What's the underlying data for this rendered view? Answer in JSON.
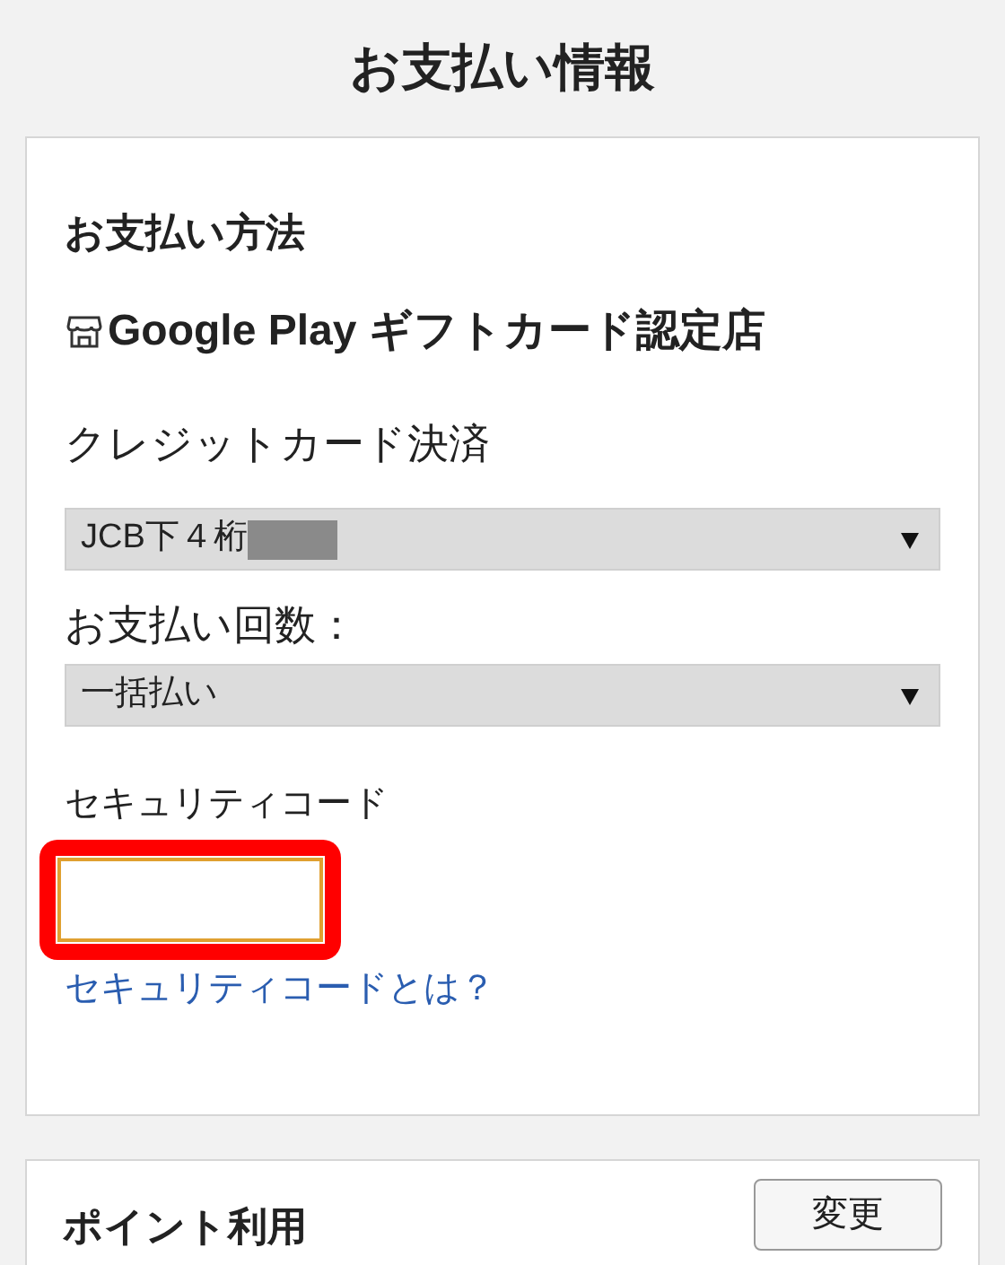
{
  "page_title": "お支払い情報",
  "payment": {
    "heading": "お支払い方法",
    "store": "Google Play ギフトカード認定店",
    "method": "クレジットカード決済",
    "card_select": {
      "value": "JCB下４桁",
      "redacted": true
    },
    "installments_label": "お支払い回数：",
    "installments_select": {
      "value": "一括払い"
    },
    "security_code": {
      "label": "セキュリティコード",
      "highlighted": true
    },
    "help_link": "セキュリティコードとは？"
  },
  "points": {
    "heading": "ポイント利用",
    "button": "変更"
  }
}
